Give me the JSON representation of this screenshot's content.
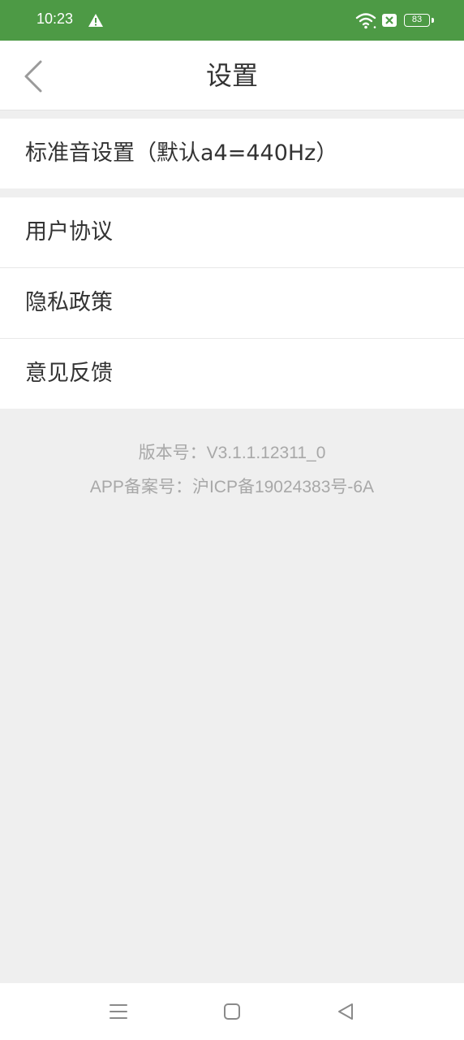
{
  "status_bar": {
    "time": "10:23",
    "battery_level": "83",
    "icons": [
      "warning-icon",
      "wifi-icon",
      "sim-icon",
      "battery-icon"
    ],
    "background": "#4d9a45"
  },
  "header": {
    "title": "设置",
    "back_icon": "chevron-left-icon"
  },
  "settings": {
    "standard_tone": "标准音设置（默认a4=440Hz）",
    "items": [
      {
        "label": "用户协议"
      },
      {
        "label": "隐私政策"
      },
      {
        "label": "意见反馈"
      }
    ]
  },
  "footer": {
    "version": "版本号：V3.1.1.12311_0",
    "icp": "APP备案号：沪ICP备19024383号-6A"
  },
  "system_nav": {
    "icons": [
      "menu-icon",
      "home-icon",
      "back-icon"
    ]
  }
}
